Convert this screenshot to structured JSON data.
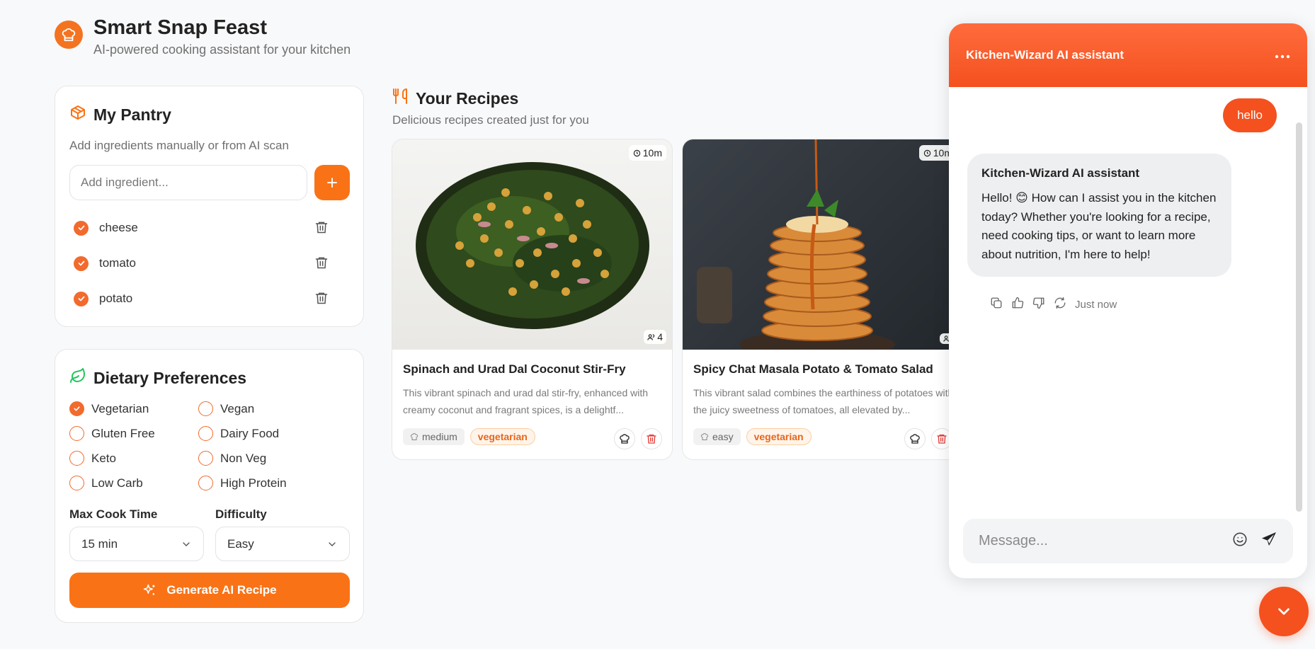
{
  "app": {
    "title": "Smart Snap Feast",
    "subtitle": "AI-powered cooking assistant for your kitchen"
  },
  "pantry": {
    "title": "My Pantry",
    "subtitle": "Add ingredients manually or from AI scan",
    "input_placeholder": "Add ingredient...",
    "items": [
      {
        "name": "cheese",
        "checked": true
      },
      {
        "name": "tomato",
        "checked": true
      },
      {
        "name": "potato",
        "checked": true
      }
    ]
  },
  "dietary": {
    "title": "Dietary Preferences",
    "options": [
      {
        "label": "Vegetarian",
        "selected": true
      },
      {
        "label": "Vegan",
        "selected": false
      },
      {
        "label": "Gluten Free",
        "selected": false
      },
      {
        "label": "Dairy Food",
        "selected": false
      },
      {
        "label": "Keto",
        "selected": false
      },
      {
        "label": "Non Veg",
        "selected": false
      },
      {
        "label": "Low Carb",
        "selected": false
      },
      {
        "label": "High Protein",
        "selected": false
      }
    ],
    "max_cook_time_label": "Max Cook Time",
    "max_cook_time_value": "15 min",
    "difficulty_label": "Difficulty",
    "difficulty_value": "Easy",
    "generate_button": "Generate AI Recipe"
  },
  "recipes": {
    "title": "Your Recipes",
    "subtitle": "Delicious recipes created just for you",
    "items": [
      {
        "title": "Spinach and Urad Dal Coconut Stir-Fry",
        "description": "This vibrant spinach and urad dal stir-fry, enhanced with creamy coconut and fragrant spices, is a delightf...",
        "time": "10m",
        "servings": "4",
        "difficulty": "medium",
        "diet_tag": "vegetarian"
      },
      {
        "title": "Spicy Chat Masala Potato & Tomato Salad",
        "description": "This vibrant salad combines the earthiness of potatoes with the juicy sweetness of tomatoes, all elevated by...",
        "time": "10m",
        "servings": "",
        "difficulty": "easy",
        "diet_tag": "vegetarian"
      }
    ]
  },
  "chat": {
    "title": "Kitchen-Wizard AI assistant",
    "user_message": "hello",
    "bot_name": "Kitchen-Wizard AI assistant",
    "bot_message": "Hello! 😊 How can I assist you in the kitchen today? Whether you're looking for a recipe, need cooking tips, or want to learn more about nutrition, I'm here to help!",
    "timestamp": "Just now",
    "input_placeholder": "Message..."
  },
  "colors": {
    "accent": "#f97316",
    "chat_accent": "#f4511e",
    "background": "#f8f9fb"
  }
}
